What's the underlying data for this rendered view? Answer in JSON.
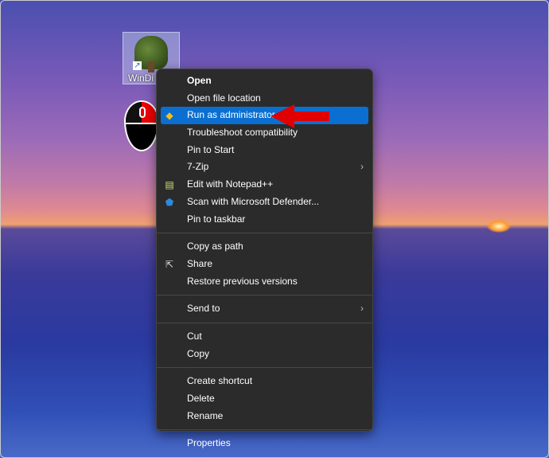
{
  "desktop": {
    "icon_label": "WinDi"
  },
  "menu": {
    "groups": [
      [
        {
          "label": "Open",
          "bold": true
        },
        {
          "label": "Open file location"
        },
        {
          "label": "Run as administrator",
          "icon": "uac-shield-icon",
          "highlighted": true
        },
        {
          "label": "Troubleshoot compatibility"
        },
        {
          "label": "Pin to Start"
        },
        {
          "label": "7-Zip",
          "submenu": true
        },
        {
          "label": "Edit with Notepad++",
          "icon": "notepad-plus-plus-icon"
        },
        {
          "label": "Scan with Microsoft Defender...",
          "icon": "defender-shield-icon"
        },
        {
          "label": "Pin to taskbar"
        }
      ],
      [
        {
          "label": "Copy as path"
        },
        {
          "label": "Share",
          "icon": "share-icon"
        },
        {
          "label": "Restore previous versions"
        }
      ],
      [
        {
          "label": "Send to",
          "submenu": true
        }
      ],
      [
        {
          "label": "Cut"
        },
        {
          "label": "Copy"
        }
      ],
      [
        {
          "label": "Create shortcut"
        },
        {
          "label": "Delete"
        },
        {
          "label": "Rename"
        }
      ],
      [
        {
          "label": "Properties"
        }
      ]
    ]
  },
  "colors": {
    "highlight": "#0a6fd0",
    "menu_bg": "#2b2b2b",
    "arrow": "#e00000"
  }
}
